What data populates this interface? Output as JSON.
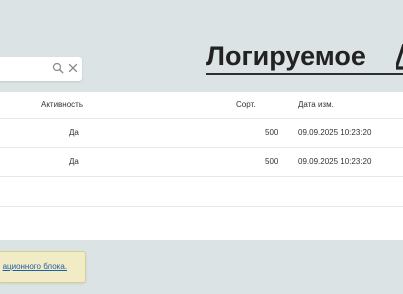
{
  "search": {
    "value": "",
    "placeholder": ""
  },
  "header": {
    "title": "Логируемое "
  },
  "table": {
    "columns": [
      "Активность",
      "Сорт.",
      "Дата изм."
    ],
    "rows": [
      {
        "active": "Да",
        "sort": "500",
        "date": "09.09.2025 10:23:20"
      },
      {
        "active": "Да",
        "sort": "500",
        "date": "09.09.2025 10:23:20"
      }
    ]
  },
  "notice": {
    "link_text": "ационного блока."
  },
  "colors": {
    "background": "#dbe3e4",
    "card": "#ffffff",
    "notice_bg": "#f2ecc6",
    "link": "#1f5ea8"
  }
}
